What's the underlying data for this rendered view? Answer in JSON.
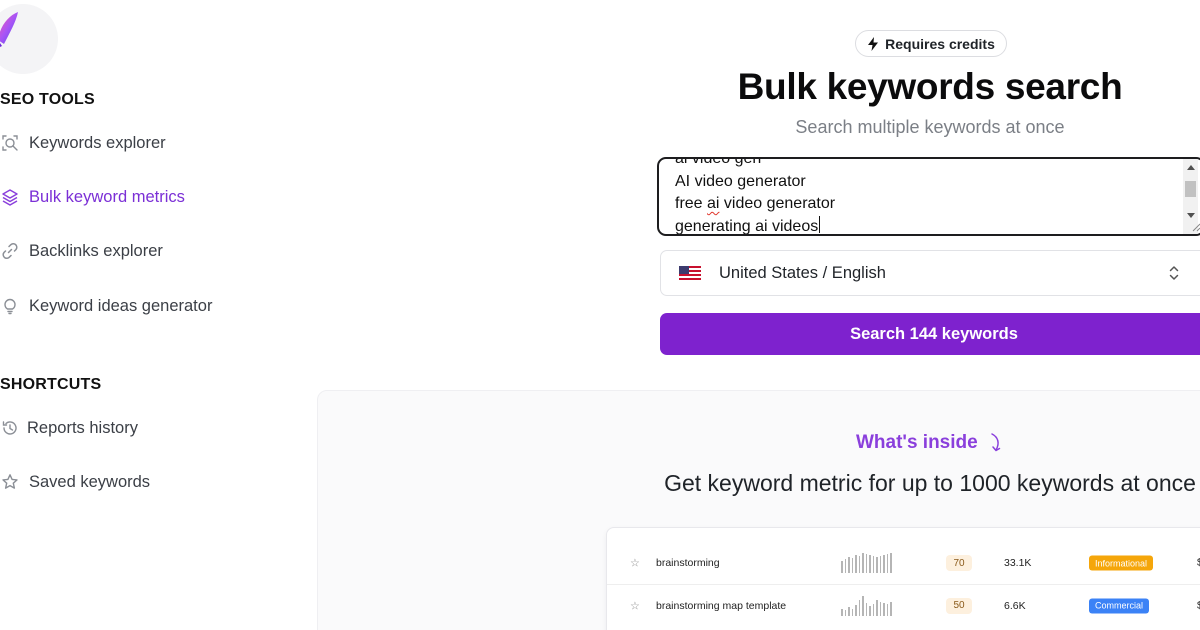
{
  "colors": {
    "accent": "#7e22ce",
    "accent_text": "#7b2fd6",
    "informational": "#f5a60a",
    "commercial": "#3b82f6"
  },
  "sidebar": {
    "seo_tools_title": "SEO TOOLS",
    "tools": [
      {
        "label": "Keywords explorer",
        "icon": "search-icon",
        "active": false
      },
      {
        "label": "Bulk keyword metrics",
        "icon": "layers-icon",
        "active": true
      },
      {
        "label": "Backlinks explorer",
        "icon": "link-icon",
        "active": false
      },
      {
        "label": "Keyword ideas generator",
        "icon": "lightbulb-icon",
        "active": false
      }
    ],
    "shortcuts_title": "SHORTCUTS",
    "shortcuts": [
      {
        "label": "Reports history",
        "icon": "history-icon"
      },
      {
        "label": "Saved keywords",
        "icon": "star-icon"
      }
    ]
  },
  "header": {
    "credits_badge": "Requires credits",
    "title": "Bulk keywords search",
    "subtitle": "Search multiple keywords at once"
  },
  "keywords_input": {
    "partial_line": "ai video gen",
    "lines": [
      "AI video generator",
      "free ai video generator",
      "generating ai videos"
    ]
  },
  "locale_select": {
    "value": "United States / English",
    "flag": "us-flag-icon"
  },
  "search_button": {
    "label": "Search 144 keywords"
  },
  "inside": {
    "label": "What's inside",
    "headline": "Get keyword metric for up to 1000 keywords at once"
  },
  "preview_table": {
    "rows": [
      {
        "keyword": "brainstorming",
        "trend": [
          12,
          14,
          16,
          15,
          18,
          17,
          20,
          19,
          18,
          17,
          16,
          17,
          18,
          19,
          20
        ],
        "kd": "70",
        "volume": "33.1K",
        "intent": "Informational",
        "intent_color": "#f5a60a",
        "extra": "$"
      },
      {
        "keyword": "brainstorming map template",
        "trend": [
          6,
          5,
          8,
          6,
          10,
          14,
          18,
          12,
          9,
          11,
          14,
          13,
          12,
          11,
          13
        ],
        "kd": "50",
        "volume": "6.6K",
        "intent": "Commercial",
        "intent_color": "#3b82f6",
        "extra": "$"
      }
    ]
  }
}
